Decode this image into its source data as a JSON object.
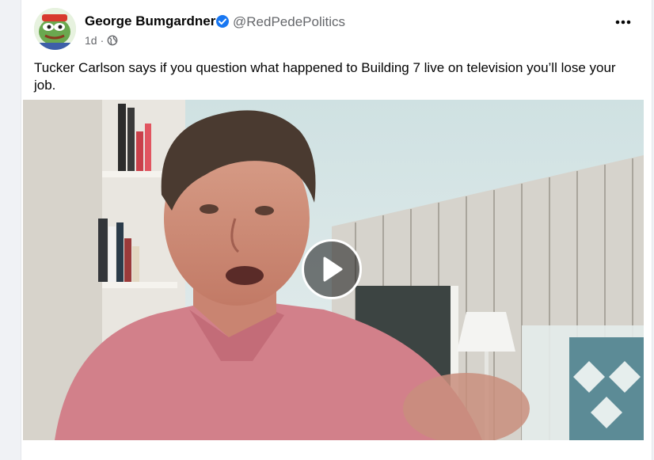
{
  "post": {
    "author_name": "George Bumgardner",
    "author_handle": "@RedPedePolitics",
    "time": "1d",
    "separator": "·",
    "text": "Tucker Carlson says if you question what happened to Building 7 live on television you’ll lose your job."
  },
  "icons": {
    "verified": "verified-badge-icon",
    "audience": "globe-icon",
    "more": "more-options-icon",
    "play": "play-icon"
  },
  "colors": {
    "verified_blue": "#1877f2",
    "text_primary": "#050505",
    "text_secondary": "#65676b"
  }
}
